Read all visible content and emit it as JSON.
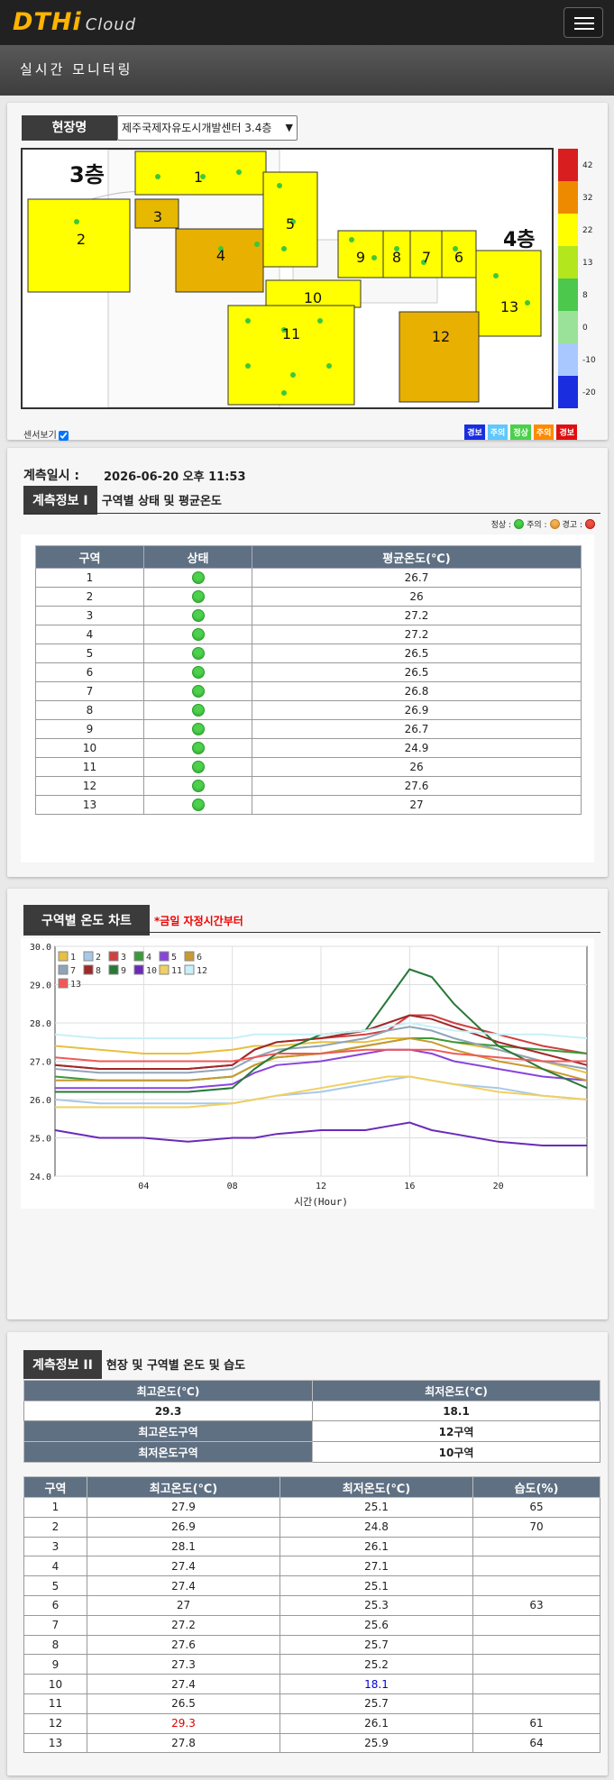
{
  "app": {
    "logo": "DTHi",
    "logo_sub": "Cloud",
    "page_title": "실시간 모니터링"
  },
  "site": {
    "label": "현장명",
    "selected": "제주국제자유도시개발센터 3.4층"
  },
  "map": {
    "floor3": "3층",
    "floor4": "4층",
    "zones": [
      "1",
      "2",
      "3",
      "4",
      "5",
      "6",
      "7",
      "8",
      "9",
      "10",
      "11",
      "12",
      "13"
    ]
  },
  "color_scale": {
    "labels": [
      "42",
      "32",
      "22",
      "13",
      "8",
      "0",
      "-10",
      "-20"
    ],
    "colors": [
      "#d81e1e",
      "#ee8a00",
      "#ffff00",
      "#b4e61e",
      "#4cc84c",
      "#9ae29a",
      "#a8c8ff",
      "#1a2ee0"
    ]
  },
  "sensor_toggle": {
    "label": "센서보기",
    "checked": true
  },
  "status_legend": [
    {
      "label": "경보",
      "color": "#1a2ee0"
    },
    {
      "label": "주의",
      "color": "#5ec8ff"
    },
    {
      "label": "정상",
      "color": "#4cd04c"
    },
    {
      "label": "주의",
      "color": "#ff8a00"
    },
    {
      "label": "경보",
      "color": "#e01010"
    }
  ],
  "measure1": {
    "time_label": "계측일시 :",
    "time_value": "2026-06-20 오후 11:53",
    "section_label": "계측정보 I",
    "section_sub": "구역별 상태 및 평균온도",
    "legend": {
      "normal": "정상 :",
      "caution": "주의 :",
      "warning": "경고 :"
    },
    "columns": [
      "구역",
      "상태",
      "평균온도(℃)"
    ],
    "rows": [
      [
        "1",
        "26.7"
      ],
      [
        "2",
        "26"
      ],
      [
        "3",
        "27.2"
      ],
      [
        "4",
        "27.2"
      ],
      [
        "5",
        "26.5"
      ],
      [
        "6",
        "26.5"
      ],
      [
        "7",
        "26.8"
      ],
      [
        "8",
        "26.9"
      ],
      [
        "9",
        "26.7"
      ],
      [
        "10",
        "24.9"
      ],
      [
        "11",
        "26"
      ],
      [
        "12",
        "27.6"
      ],
      [
        "13",
        "27"
      ]
    ]
  },
  "chart_section": {
    "label": "구역별 온도 차트",
    "note": "*금일 자정시간부터"
  },
  "chart_data": {
    "type": "line",
    "xlabel": "시간(Hour)",
    "ylabel": "",
    "xlim": [
      0,
      24
    ],
    "ylim": [
      24.0,
      30.0
    ],
    "yticks": [
      "24.0",
      "25.0",
      "26.0",
      "27.0",
      "28.0",
      "29.0",
      "30.0"
    ],
    "xticks": [
      "04",
      "08",
      "12",
      "16",
      "20"
    ],
    "grid": true,
    "legend_position": "top-left",
    "x": [
      0,
      2,
      4,
      6,
      8,
      9,
      10,
      12,
      14,
      15,
      16,
      17,
      18,
      20,
      22,
      24
    ],
    "series": [
      {
        "name": "1",
        "color": "#e8c040",
        "values": [
          27.4,
          27.3,
          27.2,
          27.2,
          27.3,
          27.4,
          27.4,
          27.5,
          27.5,
          27.6,
          27.6,
          27.6,
          27.5,
          27.3,
          27.0,
          26.7
        ]
      },
      {
        "name": "2",
        "color": "#a8c8e8",
        "values": [
          26.0,
          25.9,
          25.9,
          25.9,
          25.9,
          26.0,
          26.1,
          26.2,
          26.4,
          26.5,
          26.6,
          26.5,
          26.4,
          26.3,
          26.1,
          26.0
        ]
      },
      {
        "name": "3",
        "color": "#d04040",
        "values": [
          26.9,
          26.8,
          26.8,
          26.8,
          26.9,
          27.3,
          27.5,
          27.6,
          27.7,
          27.8,
          28.2,
          28.2,
          28.0,
          27.7,
          27.4,
          27.2
        ]
      },
      {
        "name": "4",
        "color": "#3a9a3a",
        "values": [
          26.6,
          26.5,
          26.5,
          26.5,
          26.6,
          26.9,
          27.1,
          27.2,
          27.4,
          27.5,
          27.6,
          27.6,
          27.5,
          27.4,
          27.3,
          27.2
        ]
      },
      {
        "name": "5",
        "color": "#8844dd",
        "values": [
          26.3,
          26.3,
          26.3,
          26.3,
          26.4,
          26.7,
          26.9,
          27.0,
          27.2,
          27.3,
          27.3,
          27.2,
          27.0,
          26.8,
          26.6,
          26.5
        ]
      },
      {
        "name": "6",
        "color": "#c89a30",
        "values": [
          26.5,
          26.5,
          26.5,
          26.5,
          26.6,
          26.9,
          27.1,
          27.2,
          27.4,
          27.5,
          27.6,
          27.5,
          27.3,
          27.0,
          26.8,
          26.5
        ]
      },
      {
        "name": "7",
        "color": "#90a4b8",
        "values": [
          26.8,
          26.7,
          26.7,
          26.7,
          26.8,
          27.1,
          27.3,
          27.4,
          27.6,
          27.8,
          27.9,
          27.8,
          27.6,
          27.3,
          27.0,
          26.8
        ]
      },
      {
        "name": "8",
        "color": "#a02828",
        "values": [
          26.9,
          26.8,
          26.8,
          26.8,
          26.9,
          27.3,
          27.5,
          27.6,
          27.8,
          28.0,
          28.2,
          28.1,
          27.9,
          27.5,
          27.2,
          26.9
        ]
      },
      {
        "name": "9",
        "color": "#287838",
        "values": [
          26.2,
          26.2,
          26.2,
          26.2,
          26.3,
          26.8,
          27.2,
          27.7,
          27.8,
          28.6,
          29.4,
          29.2,
          28.5,
          27.4,
          26.8,
          26.3
        ]
      },
      {
        "name": "10",
        "color": "#6a2ab8",
        "values": [
          25.2,
          25.0,
          25.0,
          24.9,
          25.0,
          25.0,
          25.1,
          25.2,
          25.2,
          25.3,
          25.4,
          25.2,
          25.1,
          24.9,
          24.8,
          24.8
        ]
      },
      {
        "name": "11",
        "color": "#f0d060",
        "values": [
          25.8,
          25.8,
          25.8,
          25.8,
          25.9,
          26.0,
          26.1,
          26.3,
          26.5,
          26.6,
          26.6,
          26.5,
          26.4,
          26.2,
          26.1,
          26.0
        ]
      },
      {
        "name": "12",
        "color": "#c8f0f8",
        "values": [
          27.7,
          27.6,
          27.6,
          27.6,
          27.6,
          27.7,
          27.7,
          27.7,
          27.8,
          27.9,
          28.0,
          27.9,
          27.8,
          27.7,
          27.7,
          27.6
        ]
      },
      {
        "name": "13",
        "color": "#f05858",
        "values": [
          27.1,
          27.0,
          27.0,
          27.0,
          27.0,
          27.1,
          27.2,
          27.2,
          27.3,
          27.3,
          27.3,
          27.3,
          27.2,
          27.1,
          27.0,
          27.0
        ]
      }
    ]
  },
  "measure2": {
    "section_label": "계측정보 II",
    "section_sub": "현장 및 구역별 온도 및 습도",
    "summary_headers": [
      "최고온도(℃)",
      "최저온도(℃)"
    ],
    "summary_values": [
      "29.3",
      "18.1"
    ],
    "max_zone_label": "최고온도구역",
    "max_zone_value": "12구역",
    "min_zone_label": "최저온도구역",
    "min_zone_value": "10구역",
    "columns": [
      "구역",
      "최고온도(℃)",
      "최저온도(℃)",
      "습도(%)"
    ],
    "rows": [
      [
        "1",
        "27.9",
        "25.1",
        "65"
      ],
      [
        "2",
        "26.9",
        "24.8",
        "70"
      ],
      [
        "3",
        "28.1",
        "26.1",
        ""
      ],
      [
        "4",
        "27.4",
        "27.1",
        ""
      ],
      [
        "5",
        "27.4",
        "25.1",
        ""
      ],
      [
        "6",
        "27",
        "25.3",
        "63"
      ],
      [
        "7",
        "27.2",
        "25.6",
        ""
      ],
      [
        "8",
        "27.6",
        "25.7",
        ""
      ],
      [
        "9",
        "27.3",
        "25.2",
        ""
      ],
      [
        "10",
        "27.4",
        "18.1",
        ""
      ],
      [
        "11",
        "26.5",
        "25.7",
        ""
      ],
      [
        "12",
        "29.3",
        "26.1",
        "61"
      ],
      [
        "13",
        "27.8",
        "25.9",
        "64"
      ]
    ]
  }
}
